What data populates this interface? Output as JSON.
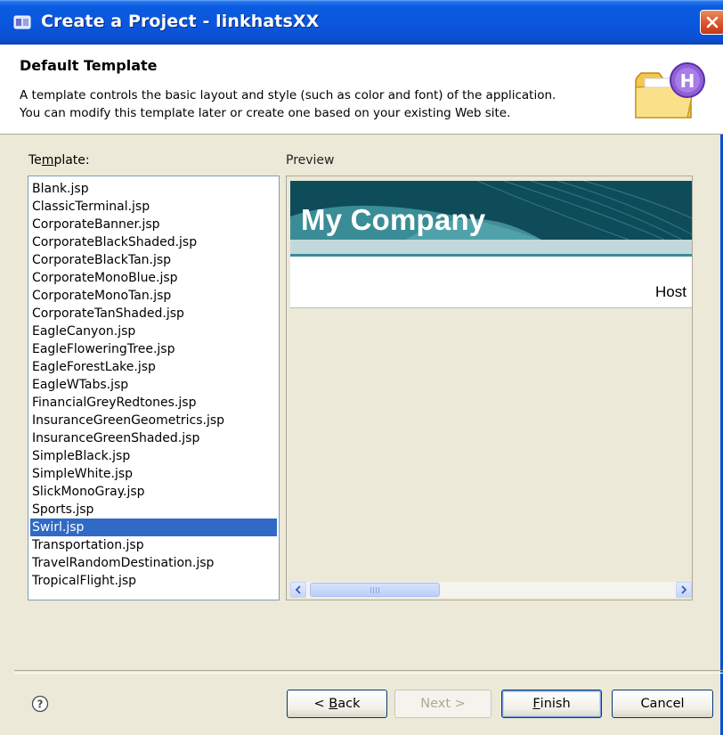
{
  "window": {
    "title": "Create a Project - linkhatsXX"
  },
  "header": {
    "title": "Default Template",
    "description_line1": "A template controls the basic layout and style (such as color and font) of the application.",
    "description_line2": "You can modify this template later or create one based on your existing Web site."
  },
  "template_list": {
    "label_prefix": "Te",
    "label_mnemonic": "m",
    "label_suffix": "plate:",
    "items": [
      "Blank.jsp",
      "ClassicTerminal.jsp",
      "CorporateBanner.jsp",
      "CorporateBlackShaded.jsp",
      "CorporateBlackTan.jsp",
      "CorporateMonoBlue.jsp",
      "CorporateMonoTan.jsp",
      "CorporateTanShaded.jsp",
      "EagleCanyon.jsp",
      "EagleFloweringTree.jsp",
      "EagleForestLake.jsp",
      "EagleWTabs.jsp",
      "FinancialGreyRedtones.jsp",
      "InsuranceGreenGeometrics.jsp",
      "InsuranceGreenShaded.jsp",
      "SimpleBlack.jsp",
      "SimpleWhite.jsp",
      "SlickMonoGray.jsp",
      "Sports.jsp",
      "Swirl.jsp",
      "Transportation.jsp",
      "TravelRandomDestination.jsp",
      "TropicalFlight.jsp"
    ],
    "selected": "Swirl.jsp"
  },
  "preview": {
    "label": "Preview",
    "banner_text": "My Company",
    "host_text": "Host"
  },
  "buttons": {
    "back_mnemonic": "B",
    "back_rest": "ack",
    "back_prefix": "< ",
    "next_label": "Next >",
    "finish_mnemonic": "F",
    "finish_rest": "inish",
    "cancel_label": "Cancel"
  },
  "colors": {
    "titlebar": "#0a55dc",
    "selection": "#316ac5",
    "banner": "#0e4c5a",
    "dialog_bg": "#ece9d8"
  },
  "icons": [
    "app-icon",
    "close-icon",
    "folder-h-icon",
    "help-icon",
    "arrow-up-icon",
    "arrow-down-icon",
    "arrow-left-icon",
    "arrow-right-icon"
  ]
}
